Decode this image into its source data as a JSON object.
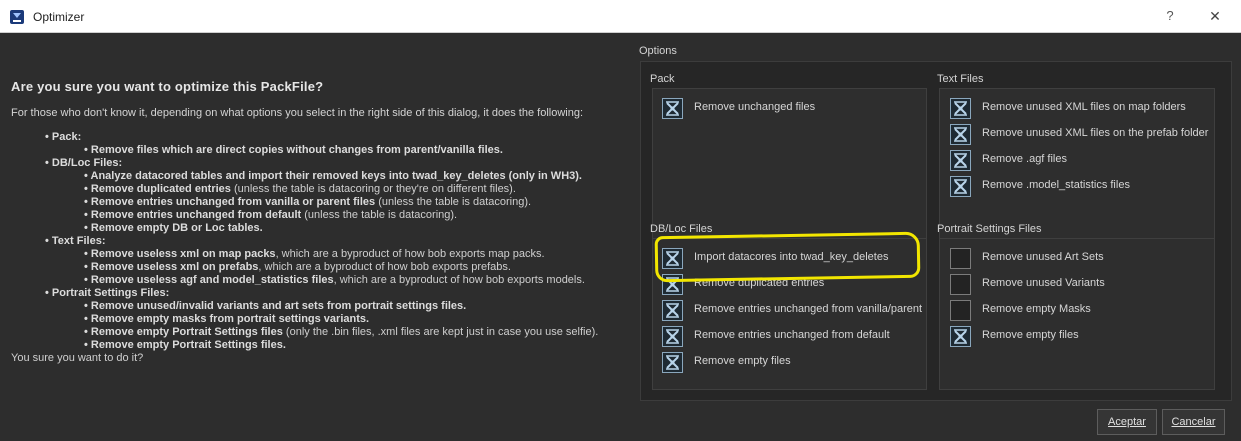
{
  "window": {
    "title": "Optimizer",
    "help_glyph": "?",
    "close_glyph": "✕",
    "icon": "app-logo-icon"
  },
  "left": {
    "heading": "Are you sure you want to optimize this PackFile?",
    "intro": "For those who don't know it, depending on what options you select in the right side of this dialog, it does the following:",
    "sections": [
      {
        "title": "• Pack:",
        "items": [
          {
            "bold": "• Remove files which are direct copies without changes from parent/vanilla files.",
            "rest": ""
          }
        ]
      },
      {
        "title": "• DB/Loc Files:",
        "items": [
          {
            "bold": "• Analyze datacored tables and import their removed keys into twad_key_deletes (only in WH3).",
            "rest": ""
          },
          {
            "bold": "• Remove duplicated entries",
            "rest": " (unless the table is datacoring or they're on different files)."
          },
          {
            "bold": "• Remove entries unchanged from vanilla or parent files",
            "rest": " (unless the table is datacoring)."
          },
          {
            "bold": "• Remove entries unchanged from default",
            "rest": " (unless the table is datacoring)."
          },
          {
            "bold": "• Remove empty DB or Loc tables.",
            "rest": ""
          }
        ]
      },
      {
        "title": "• Text Files:",
        "items": [
          {
            "bold": "• Remove useless xml on map packs",
            "rest": ", which are a byproduct of how bob exports map packs."
          },
          {
            "bold": "• Remove useless xml on prefabs",
            "rest": ", which are a byproduct of how bob exports prefabs."
          },
          {
            "bold": "• Remove useless agf and model_statistics files",
            "rest": ", which are a byproduct of how bob exports models."
          }
        ]
      },
      {
        "title": "• Portrait Settings Files:",
        "items": [
          {
            "bold": "• Remove unused/invalid variants and art sets from portrait settings files.",
            "rest": ""
          },
          {
            "bold": "• Remove empty masks from portrait settings variants.",
            "rest": ""
          },
          {
            "bold": "• Remove empty Portrait Settings files",
            "rest": " (only the .bin files, .xml files are kept just in case you use selfie)."
          },
          {
            "bold": "• Remove empty Portrait Settings files.",
            "rest": ""
          }
        ]
      }
    ],
    "footer": "You sure you want to do it?"
  },
  "options": {
    "label": "Options",
    "groups": {
      "pack": {
        "title": "Pack",
        "items": [
          {
            "label": "Remove unchanged files",
            "checked": true
          }
        ]
      },
      "text": {
        "title": "Text Files",
        "items": [
          {
            "label": "Remove unused XML files on map folders",
            "checked": true
          },
          {
            "label": "Remove unused XML files on the prefab folder",
            "checked": true
          },
          {
            "label": "Remove .agf files",
            "checked": true
          },
          {
            "label": "Remove .model_statistics files",
            "checked": true
          }
        ]
      },
      "db": {
        "title": "DB/Loc Files",
        "items": [
          {
            "label": "Import datacores into twad_key_deletes",
            "checked": true
          },
          {
            "label": "Remove duplicated entries",
            "checked": true
          },
          {
            "label": "Remove entries unchanged from vanilla/parent",
            "checked": true
          },
          {
            "label": "Remove entries unchanged from default",
            "checked": true
          },
          {
            "label": "Remove empty files",
            "checked": true
          }
        ]
      },
      "portrait": {
        "title": "Portrait Settings Files",
        "items": [
          {
            "label": "Remove unused Art Sets",
            "checked": false
          },
          {
            "label": "Remove unused Variants",
            "checked": false
          },
          {
            "label": "Remove empty Masks",
            "checked": false
          },
          {
            "label": "Remove empty files",
            "checked": true
          }
        ]
      }
    }
  },
  "buttons": {
    "accept": "Aceptar",
    "cancel": "Cancelar"
  },
  "colors": {
    "highlight": "#f2e600",
    "background": "#2d2d2d"
  }
}
